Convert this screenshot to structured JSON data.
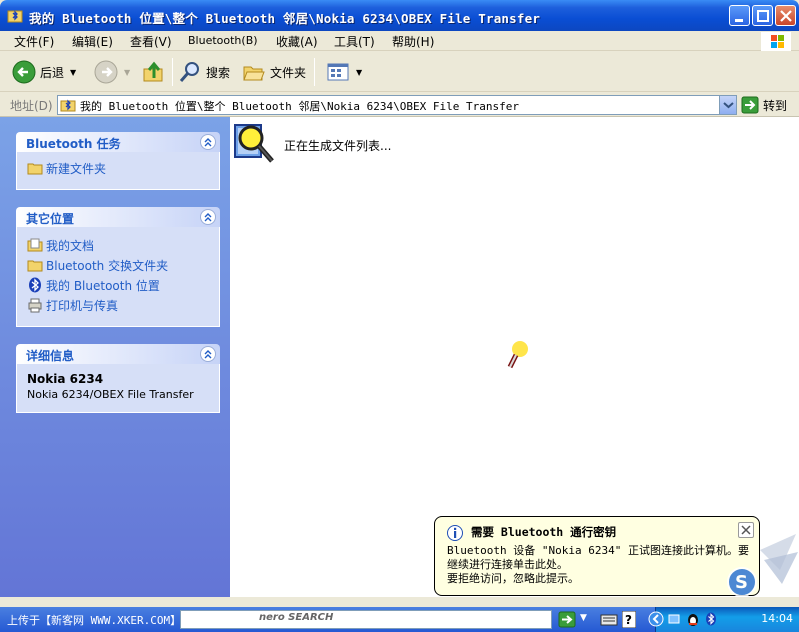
{
  "window": {
    "title": "我的 Bluetooth 位置\\整个 Bluetooth 邻居\\Nokia 6234\\OBEX File Transfer"
  },
  "menu": [
    "文件(F)",
    "编辑(E)",
    "查看(V)",
    "Bluetooth(B)",
    "收藏(A)",
    "工具(T)",
    "帮助(H)"
  ],
  "toolbar": {
    "back_label": "后退",
    "search_label": "搜索",
    "folders_label": "文件夹"
  },
  "address": {
    "label": "地址(D)",
    "value": "我的 Bluetooth 位置\\整个 Bluetooth 邻居\\Nokia 6234\\OBEX File Transfer",
    "go_label": "转到"
  },
  "taskpane": {
    "tasks": {
      "title": "Bluetooth 任务",
      "items": [
        "新建文件夹"
      ]
    },
    "other": {
      "title": "其它位置",
      "items": [
        "我的文档",
        "Bluetooth 交换文件夹",
        "我的 Bluetooth 位置",
        "打印机与传真"
      ]
    },
    "details": {
      "title": "详细信息",
      "name": "Nokia 6234",
      "desc": "Nokia 6234/OBEX File Transfer"
    }
  },
  "content": {
    "status": "正在生成文件列表..."
  },
  "balloon": {
    "title": "需要 Bluetooth 通行密钥",
    "body1": "Bluetooth 设备 \"Nokia 6234\" 正试图连接此计算机。要继续进行连接单击此处。",
    "body2": "要拒绝访问，忽略此提示。"
  },
  "taskbar": {
    "text": "上传于【新客网 WWW.XKER.COM】",
    "clock": "14:04",
    "nero": "nero SEARCH"
  },
  "colors": {
    "title_blue": "#0a4ed4",
    "taskpane_blue": "#7ba2e7",
    "link_blue": "#215dc6",
    "balloon_bg": "#ffffe1"
  }
}
